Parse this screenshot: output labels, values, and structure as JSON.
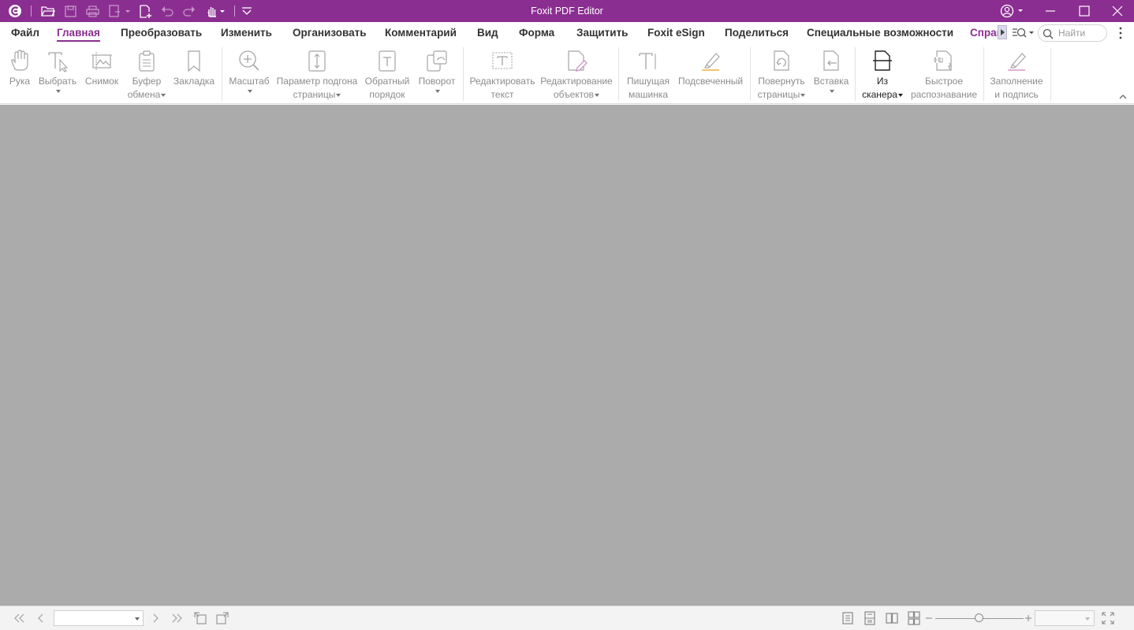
{
  "app": {
    "title": "Foxit PDF Editor",
    "accent_color": "#8b2e91",
    "canvas_color": "#ababab"
  },
  "quick_access": [
    "foxit-logo-icon",
    "open-folder-icon",
    "save-icon",
    "print-icon",
    "create-icon",
    "new-file-icon",
    "undo-icon",
    "redo-icon",
    "hand-tool-icon",
    "customize-icon"
  ],
  "window_controls": [
    "account-icon",
    "minimize-icon",
    "maximize-icon",
    "close-icon"
  ],
  "menu": {
    "tabs": [
      {
        "label": "Файл"
      },
      {
        "label": "Главная",
        "active": true
      },
      {
        "label": "Преобразовать"
      },
      {
        "label": "Изменить"
      },
      {
        "label": "Организовать"
      },
      {
        "label": "Комментарий"
      },
      {
        "label": "Вид"
      },
      {
        "label": "Форма"
      },
      {
        "label": "Защитить"
      },
      {
        "label": "Foxit eSign"
      },
      {
        "label": "Поделиться"
      },
      {
        "label": "Специальные возможности"
      },
      {
        "label": "Справка"
      }
    ],
    "search_placeholder": "Найти"
  },
  "ribbon": {
    "hand": {
      "label": "Рука"
    },
    "select": {
      "label": "Выбрать"
    },
    "snapshot": {
      "label": "Снимок"
    },
    "clipboard": {
      "line1": "Буфер",
      "line2": "обмена"
    },
    "bookmark": {
      "label": "Закладка"
    },
    "zoom": {
      "label": "Масштаб"
    },
    "fit_page": {
      "line1": "Параметр подгона",
      "line2": "страницы"
    },
    "reverse": {
      "line1": "Обратный",
      "line2": "порядок"
    },
    "rotate": {
      "label": "Поворот"
    },
    "edit_text": {
      "line1": "Редактировать",
      "line2": "текст"
    },
    "edit_objects": {
      "line1": "Редактирование",
      "line2": "объектов"
    },
    "typewriter": {
      "line1": "Пишущая",
      "line2": "машинка"
    },
    "highlight": {
      "label": "Подсвеченный"
    },
    "rotate_pages": {
      "line1": "Повернуть",
      "line2": "страницы"
    },
    "insert": {
      "label": "Вставка"
    },
    "from_scanner": {
      "line1": "Из",
      "line2": "сканера"
    },
    "quick_ocr": {
      "line1": "Быстрое",
      "line2": "распознавание"
    },
    "fill_sign": {
      "line1": "Заполнение",
      "line2": "и подпись"
    }
  },
  "statusbar": {
    "page_value": "",
    "zoom_value": ""
  }
}
